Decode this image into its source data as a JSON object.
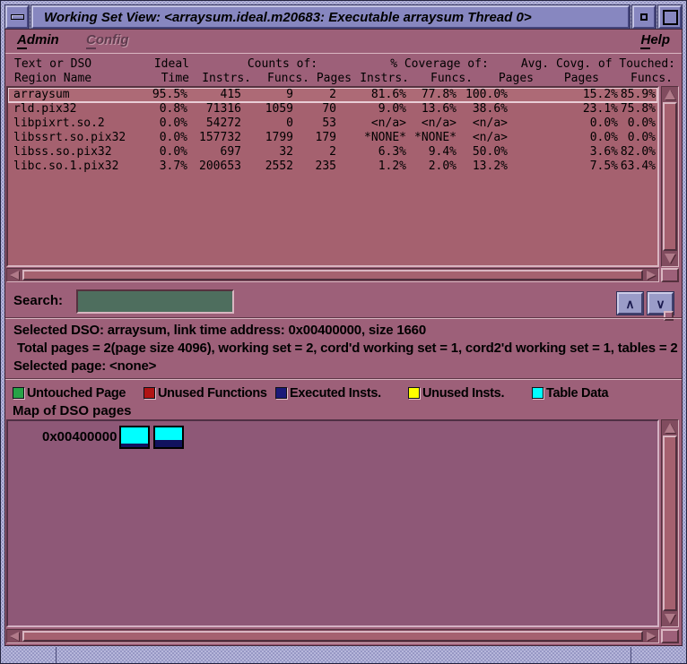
{
  "window": {
    "title": "Working Set View: <arraysum.ideal.m20683: Executable arraysum Thread 0>"
  },
  "menu": {
    "admin": {
      "initial": "A",
      "rest": "dmin"
    },
    "config": {
      "initial": "C",
      "rest": "onfig",
      "disabled": true
    },
    "help": {
      "initial": "H",
      "rest": "elp"
    }
  },
  "table": {
    "header": {
      "line1": {
        "name": "Text or DSO",
        "ideal": "Ideal",
        "counts": "Counts of:",
        "coverage": "% Coverage of:",
        "avg": "Avg. Covg. of Touched:"
      },
      "line2": {
        "name": "Region Name",
        "time": "Time",
        "instrs1": "Instrs.",
        "funcs1": "Funcs.",
        "pages1": "Pages",
        "instrs2": "Instrs.",
        "funcs2": "Funcs.",
        "pages2": "Pages",
        "pages3": "Pages",
        "funcs3": "Funcs."
      }
    },
    "rows": [
      {
        "selected": true,
        "cells": [
          "arraysum",
          "95.5%",
          "415",
          "9",
          "2",
          "81.6%",
          "77.8%",
          "100.0%",
          "15.2%",
          "85.9%"
        ]
      },
      {
        "selected": false,
        "cells": [
          "rld.pix32",
          "0.8%",
          "71316",
          "1059",
          "70",
          "9.0%",
          "13.6%",
          "38.6%",
          "23.1%",
          "75.8%"
        ]
      },
      {
        "selected": false,
        "cells": [
          "libpixrt.so.2",
          "0.0%",
          "54272",
          "0",
          "53",
          "<n/a>",
          "<n/a>",
          "<n/a>",
          "0.0%",
          "0.0%"
        ]
      },
      {
        "selected": false,
        "cells": [
          "libssrt.so.pix32",
          "0.0%",
          "157732",
          "1799",
          "179",
          "*NONE*",
          "*NONE*",
          "<n/a>",
          "0.0%",
          "0.0%"
        ]
      },
      {
        "selected": false,
        "cells": [
          "libss.so.pix32",
          "0.0%",
          "697",
          "32",
          "2",
          "6.3%",
          "9.4%",
          "50.0%",
          "3.6%",
          "82.0%"
        ]
      },
      {
        "selected": false,
        "cells": [
          "libc.so.1.pix32",
          "3.7%",
          "200653",
          "2552",
          "235",
          "1.2%",
          "2.0%",
          "13.2%",
          "7.5%",
          "63.4%"
        ]
      }
    ]
  },
  "search": {
    "label": "Search:",
    "value": "",
    "prev_icon": "∧",
    "next_icon": "∨"
  },
  "info": {
    "line1": "Selected DSO: arraysum, link time address: 0x00400000, size 1660",
    "line2": " Total pages = 2(page size 4096), working set = 2, cord'd working set = 1, cord2'd working set = 1, tables = 2",
    "line3": "Selected page: <none>"
  },
  "legend": {
    "items": [
      {
        "label": "Untouched Page",
        "color": "#27a347"
      },
      {
        "label": "Unused Functions",
        "color": "#b01414"
      },
      {
        "label": "Executed Insts.",
        "color": "#1a1a78"
      },
      {
        "label": "Unused Insts.",
        "color": "#ffff00"
      },
      {
        "label": "Table Data",
        "color": "#00ffff"
      }
    ]
  },
  "map": {
    "title": "Map of DSO pages",
    "address": "0x00400000",
    "page_fill_color": "#00ffff",
    "executed_color": "#12125e",
    "pages": [
      {
        "executed_fraction": 0.18
      },
      {
        "executed_fraction": 0.36
      }
    ]
  },
  "colors": {
    "titlebar": "#8787c0",
    "app_background": "#9d6079",
    "table_background": "#a5616f",
    "map_background": "#8e5877",
    "search_field_background": "#4e6e5e"
  }
}
